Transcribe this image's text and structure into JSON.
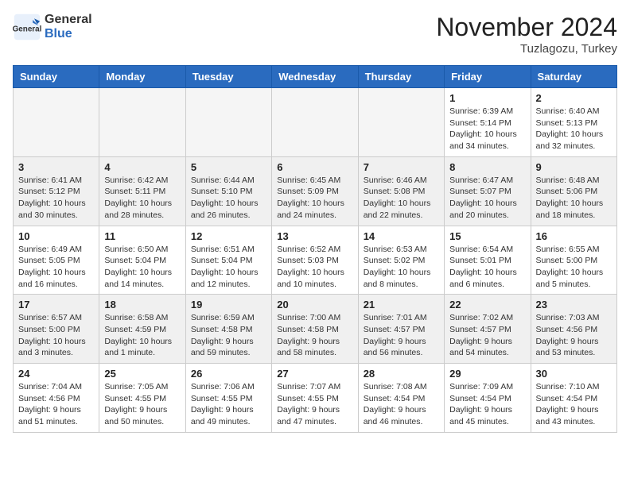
{
  "header": {
    "logo_general": "General",
    "logo_blue": "Blue",
    "month_title": "November 2024",
    "location": "Tuzlagozu, Turkey"
  },
  "weekdays": [
    "Sunday",
    "Monday",
    "Tuesday",
    "Wednesday",
    "Thursday",
    "Friday",
    "Saturday"
  ],
  "weeks": [
    [
      {
        "day": "",
        "info": ""
      },
      {
        "day": "",
        "info": ""
      },
      {
        "day": "",
        "info": ""
      },
      {
        "day": "",
        "info": ""
      },
      {
        "day": "",
        "info": ""
      },
      {
        "day": "1",
        "info": "Sunrise: 6:39 AM\nSunset: 5:14 PM\nDaylight: 10 hours\nand 34 minutes."
      },
      {
        "day": "2",
        "info": "Sunrise: 6:40 AM\nSunset: 5:13 PM\nDaylight: 10 hours\nand 32 minutes."
      }
    ],
    [
      {
        "day": "3",
        "info": "Sunrise: 6:41 AM\nSunset: 5:12 PM\nDaylight: 10 hours\nand 30 minutes."
      },
      {
        "day": "4",
        "info": "Sunrise: 6:42 AM\nSunset: 5:11 PM\nDaylight: 10 hours\nand 28 minutes."
      },
      {
        "day": "5",
        "info": "Sunrise: 6:44 AM\nSunset: 5:10 PM\nDaylight: 10 hours\nand 26 minutes."
      },
      {
        "day": "6",
        "info": "Sunrise: 6:45 AM\nSunset: 5:09 PM\nDaylight: 10 hours\nand 24 minutes."
      },
      {
        "day": "7",
        "info": "Sunrise: 6:46 AM\nSunset: 5:08 PM\nDaylight: 10 hours\nand 22 minutes."
      },
      {
        "day": "8",
        "info": "Sunrise: 6:47 AM\nSunset: 5:07 PM\nDaylight: 10 hours\nand 20 minutes."
      },
      {
        "day": "9",
        "info": "Sunrise: 6:48 AM\nSunset: 5:06 PM\nDaylight: 10 hours\nand 18 minutes."
      }
    ],
    [
      {
        "day": "10",
        "info": "Sunrise: 6:49 AM\nSunset: 5:05 PM\nDaylight: 10 hours\nand 16 minutes."
      },
      {
        "day": "11",
        "info": "Sunrise: 6:50 AM\nSunset: 5:04 PM\nDaylight: 10 hours\nand 14 minutes."
      },
      {
        "day": "12",
        "info": "Sunrise: 6:51 AM\nSunset: 5:04 PM\nDaylight: 10 hours\nand 12 minutes."
      },
      {
        "day": "13",
        "info": "Sunrise: 6:52 AM\nSunset: 5:03 PM\nDaylight: 10 hours\nand 10 minutes."
      },
      {
        "day": "14",
        "info": "Sunrise: 6:53 AM\nSunset: 5:02 PM\nDaylight: 10 hours\nand 8 minutes."
      },
      {
        "day": "15",
        "info": "Sunrise: 6:54 AM\nSunset: 5:01 PM\nDaylight: 10 hours\nand 6 minutes."
      },
      {
        "day": "16",
        "info": "Sunrise: 6:55 AM\nSunset: 5:00 PM\nDaylight: 10 hours\nand 5 minutes."
      }
    ],
    [
      {
        "day": "17",
        "info": "Sunrise: 6:57 AM\nSunset: 5:00 PM\nDaylight: 10 hours\nand 3 minutes."
      },
      {
        "day": "18",
        "info": "Sunrise: 6:58 AM\nSunset: 4:59 PM\nDaylight: 10 hours\nand 1 minute."
      },
      {
        "day": "19",
        "info": "Sunrise: 6:59 AM\nSunset: 4:58 PM\nDaylight: 9 hours\nand 59 minutes."
      },
      {
        "day": "20",
        "info": "Sunrise: 7:00 AM\nSunset: 4:58 PM\nDaylight: 9 hours\nand 58 minutes."
      },
      {
        "day": "21",
        "info": "Sunrise: 7:01 AM\nSunset: 4:57 PM\nDaylight: 9 hours\nand 56 minutes."
      },
      {
        "day": "22",
        "info": "Sunrise: 7:02 AM\nSunset: 4:57 PM\nDaylight: 9 hours\nand 54 minutes."
      },
      {
        "day": "23",
        "info": "Sunrise: 7:03 AM\nSunset: 4:56 PM\nDaylight: 9 hours\nand 53 minutes."
      }
    ],
    [
      {
        "day": "24",
        "info": "Sunrise: 7:04 AM\nSunset: 4:56 PM\nDaylight: 9 hours\nand 51 minutes."
      },
      {
        "day": "25",
        "info": "Sunrise: 7:05 AM\nSunset: 4:55 PM\nDaylight: 9 hours\nand 50 minutes."
      },
      {
        "day": "26",
        "info": "Sunrise: 7:06 AM\nSunset: 4:55 PM\nDaylight: 9 hours\nand 49 minutes."
      },
      {
        "day": "27",
        "info": "Sunrise: 7:07 AM\nSunset: 4:55 PM\nDaylight: 9 hours\nand 47 minutes."
      },
      {
        "day": "28",
        "info": "Sunrise: 7:08 AM\nSunset: 4:54 PM\nDaylight: 9 hours\nand 46 minutes."
      },
      {
        "day": "29",
        "info": "Sunrise: 7:09 AM\nSunset: 4:54 PM\nDaylight: 9 hours\nand 45 minutes."
      },
      {
        "day": "30",
        "info": "Sunrise: 7:10 AM\nSunset: 4:54 PM\nDaylight: 9 hours\nand 43 minutes."
      }
    ]
  ]
}
